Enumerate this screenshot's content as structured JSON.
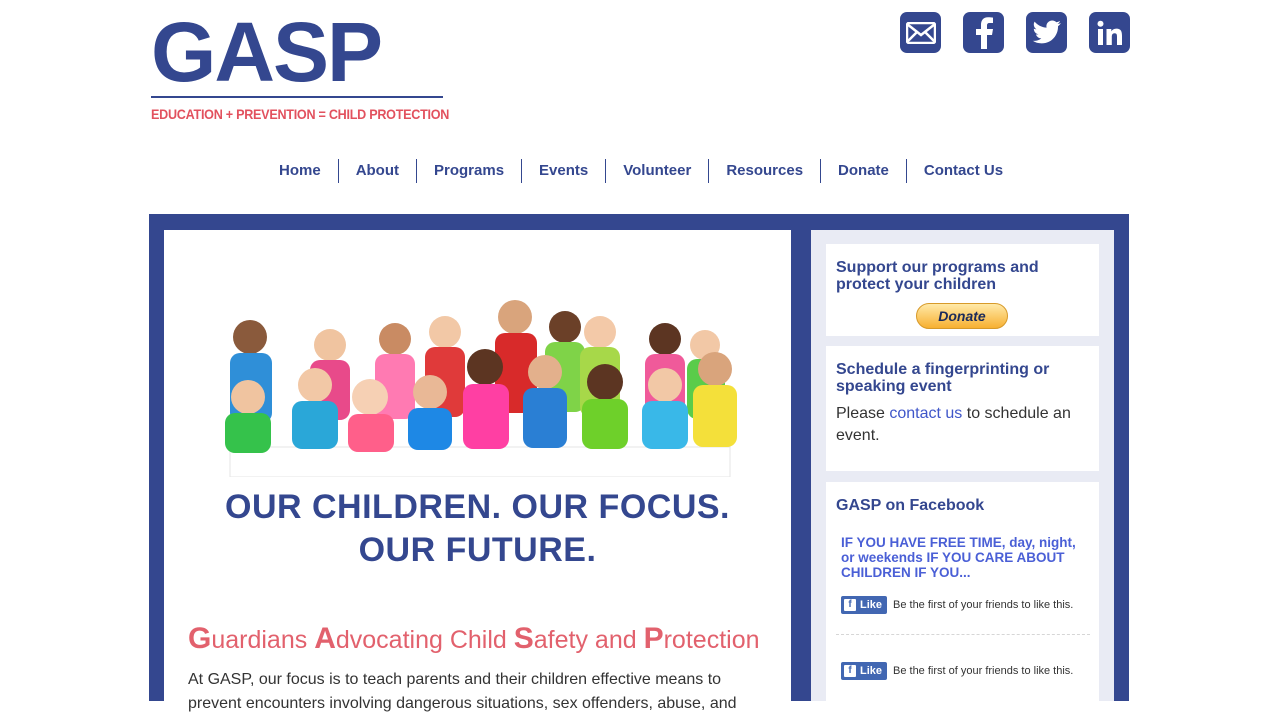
{
  "header": {
    "logo_text": "GASP",
    "tagline": "EDUCATION + PREVENTION = CHILD PROTECTION",
    "social": [
      {
        "name": "email",
        "icon": "envelope-icon"
      },
      {
        "name": "facebook",
        "icon": "facebook-icon"
      },
      {
        "name": "twitter",
        "icon": "twitter-icon"
      },
      {
        "name": "linkedin",
        "icon": "linkedin-icon"
      }
    ]
  },
  "nav": [
    "Home",
    "About",
    "Programs",
    "Events",
    "Volunteer",
    "Resources",
    "Donate",
    "Contact Us"
  ],
  "main": {
    "slogan_line1": "OUR CHILDREN. OUR FOCUS.",
    "slogan_line2": "OUR FUTURE.",
    "headline_parts": [
      "G",
      "uardians ",
      "A",
      "dvocating Child ",
      "S",
      "afety and ",
      "P",
      "rotection"
    ],
    "intro": "At GASP, our focus is to teach parents and their children effective means to prevent encounters involving dangerous situations, sex offenders, abuse, and"
  },
  "sidebar": {
    "support_title": "Support our programs and protect your children",
    "donate_label": "Donate",
    "schedule_title": "Schedule a fingerprinting or speaking event",
    "schedule_pre": "Please ",
    "schedule_link": "contact us",
    "schedule_post": " to schedule an event.",
    "facebook_title": "GASP on Facebook",
    "fb_post": "IF YOU HAVE FREE TIME, day, night, or weekends IF YOU CARE ABOUT CHILDREN IF YOU...",
    "like_label": "Like",
    "like_text": "Be the first of your friends to like this."
  },
  "colors": {
    "brand": "#34478f",
    "accent": "#e2515e",
    "link": "#3f56c9"
  }
}
